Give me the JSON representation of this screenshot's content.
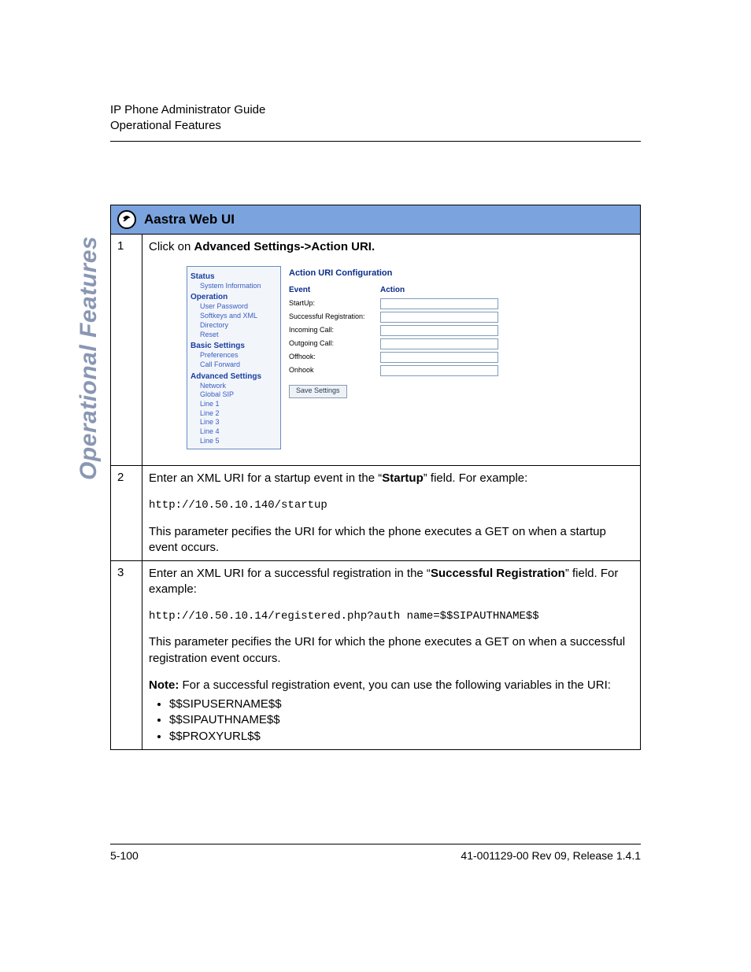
{
  "header": {
    "line1": "IP Phone Administrator Guide",
    "line2": "Operational Features"
  },
  "side_label": "Operational Features",
  "table_title": "Aastra Web UI",
  "steps": {
    "s1": {
      "num": "1",
      "pre": "Click on ",
      "bold": "Advanced Settings->Action URI."
    },
    "s2": {
      "num": "2",
      "line1_pre": "Enter an XML URI for a startup event in the “",
      "line1_bold": "Startup",
      "line1_post": "” field. For example:",
      "code": "http://10.50.10.140/startup",
      "line2": "This parameter pecifies the URI for which the phone executes a GET on when a startup event occurs."
    },
    "s3": {
      "num": "3",
      "line1_pre": "Enter an XML URI for a successful registration in the “",
      "line1_bold": "Successful Registration",
      "line1_post": "” field. For example:",
      "code": "http://10.50.10.14/registered.php?auth name=$$SIPAUTHNAME$$",
      "line2": "This parameter pecifies the URI for which the phone executes a GET on when a successful registration event occurs.",
      "note_label": "Note:",
      "note_text": " For a successful registration event, you can use the following variables in the URI:",
      "vars": {
        "v1": "$$SIPUSERNAME$$",
        "v2": "$$SIPAUTHNAME$$",
        "v3": "$$PROXYURL$$"
      }
    }
  },
  "webui": {
    "sidebar": {
      "status_h": "Status",
      "status_i1": "System Information",
      "operation_h": "Operation",
      "op_i1": "User Password",
      "op_i2": "Softkeys and XML",
      "op_i3": "Directory",
      "op_i4": "Reset",
      "basic_h": "Basic Settings",
      "bs_i1": "Preferences",
      "bs_i2": "Call Forward",
      "adv_h": "Advanced Settings",
      "adv_i1": "Network",
      "adv_i2": "Global SIP",
      "adv_i3": "Line 1",
      "adv_i4": "Line 2",
      "adv_i5": "Line 3",
      "adv_i6": "Line 4",
      "adv_i7": "Line 5"
    },
    "main": {
      "title": "Action URI Configuration",
      "col1": "Event",
      "col2": "Action",
      "r1": "StartUp:",
      "r2": "Successful Registration:",
      "r3": "Incoming Call:",
      "r4": "Outgoing Call:",
      "r5": "Offhook:",
      "r6": "Onhook",
      "save": "Save Settings"
    }
  },
  "footer": {
    "left": "5-100",
    "right": "41-001129-00 Rev 09, Release 1.4.1"
  }
}
